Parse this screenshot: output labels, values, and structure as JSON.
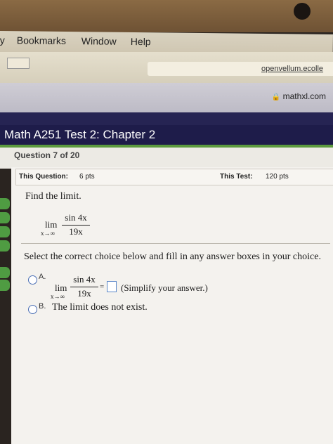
{
  "menubar": {
    "items": [
      "y",
      "Bookmarks",
      "Window",
      "Help"
    ]
  },
  "browser": {
    "url_partial": "openvellum.ecolle",
    "domain": "mathxl.com"
  },
  "header": {
    "title": "Math A251 Test 2: Chapter 2"
  },
  "question": {
    "number_label": "Question 7 of 20"
  },
  "infobar": {
    "this_question_label": "This Question:",
    "this_question_pts": "6 pts",
    "this_test_label": "This Test:",
    "this_test_pts": "120 pts"
  },
  "problem": {
    "prompt": "Find the limit.",
    "lim": "lim",
    "sub": "x→∞",
    "numerator": "sin 4x",
    "denominator": "19x"
  },
  "instructions": "Select the correct choice below and fill in any answer boxes in your choice.",
  "options": {
    "a_label": "A.",
    "a_equals": "=",
    "a_hint": "(Simplify your answer.)",
    "b_label": "B.",
    "b_text": "The limit does not exist."
  }
}
